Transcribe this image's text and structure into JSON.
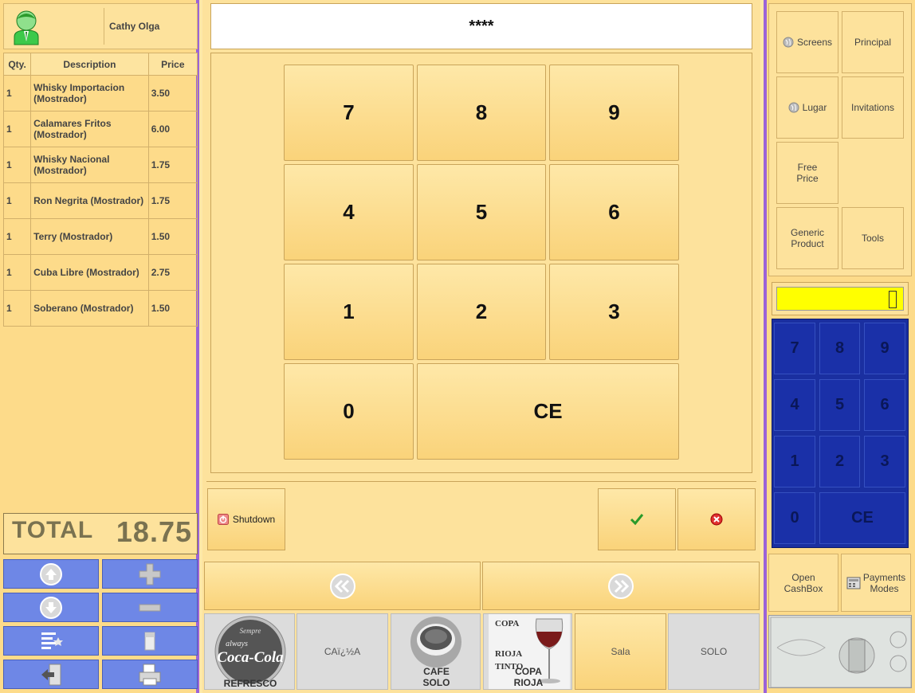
{
  "user": {
    "name": "Cathy Olga",
    "avatar_icon": "user-avatar-icon"
  },
  "ticket": {
    "headers": {
      "qty": "Qty.",
      "description": "Description",
      "price": "Price"
    },
    "rows": [
      {
        "qty": "1",
        "description": "Whisky Importacion (Mostrador)",
        "price": "3.50"
      },
      {
        "qty": "1",
        "description": "Calamares Fritos (Mostrador)",
        "price": "6.00"
      },
      {
        "qty": "1",
        "description": "Whisky Nacional (Mostrador)",
        "price": "1.75"
      },
      {
        "qty": "1",
        "description": "Ron Negrita (Mostrador)",
        "price": "1.75"
      },
      {
        "qty": "1",
        "description": "Terry (Mostrador)",
        "price": "1.50"
      },
      {
        "qty": "1",
        "description": "Cuba Libre (Mostrador)",
        "price": "2.75"
      },
      {
        "qty": "1",
        "description": "Soberano (Mostrador)",
        "price": "1.50"
      }
    ],
    "total_label": "TOTAL",
    "total_value": "18.75"
  },
  "login": {
    "password_mask": "****",
    "keys": [
      "7",
      "8",
      "9",
      "4",
      "5",
      "6",
      "1",
      "2",
      "3",
      "0",
      "CE"
    ],
    "shutdown_label": "Shutdown"
  },
  "right_menu": {
    "screens": "Screens",
    "principal": "Principal",
    "lugar": "Lugar",
    "invitations": "Invitations",
    "free_price_1": "Free",
    "free_price_2": "Price",
    "generic_1": "Generic",
    "generic_2": "Product",
    "tools": "Tools"
  },
  "cash_pad": {
    "keys": [
      "7",
      "8",
      "9",
      "4",
      "5",
      "6",
      "1",
      "2",
      "3",
      "0",
      "CE"
    ],
    "open_cashbox_1": "Open",
    "open_cashbox_2": "CashBox",
    "payments_1": "Payments",
    "payments_2": "Modes"
  },
  "products": [
    {
      "label": "REFRESCO"
    },
    {
      "label": "CAï¿½A"
    },
    {
      "label_1": "CAFE",
      "label_2": "SOLO"
    },
    {
      "label_1": "COPA",
      "label_2": "RIOJA",
      "logo_line_1": "COPA",
      "logo_line_2": "RIOJA",
      "logo_line_3": "TINTO"
    },
    {
      "label": "Sala"
    },
    {
      "label": "SOLO"
    }
  ],
  "coca_cola_logo": {
    "line_1": "Sempre",
    "line_2": "always",
    "line_3": "Coca-Cola"
  },
  "colors": {
    "accent_purple": "#9b63d8",
    "blue_pad": "#1a2fa0",
    "yellow_display": "#ffff00",
    "panel": "#fddb8a"
  }
}
